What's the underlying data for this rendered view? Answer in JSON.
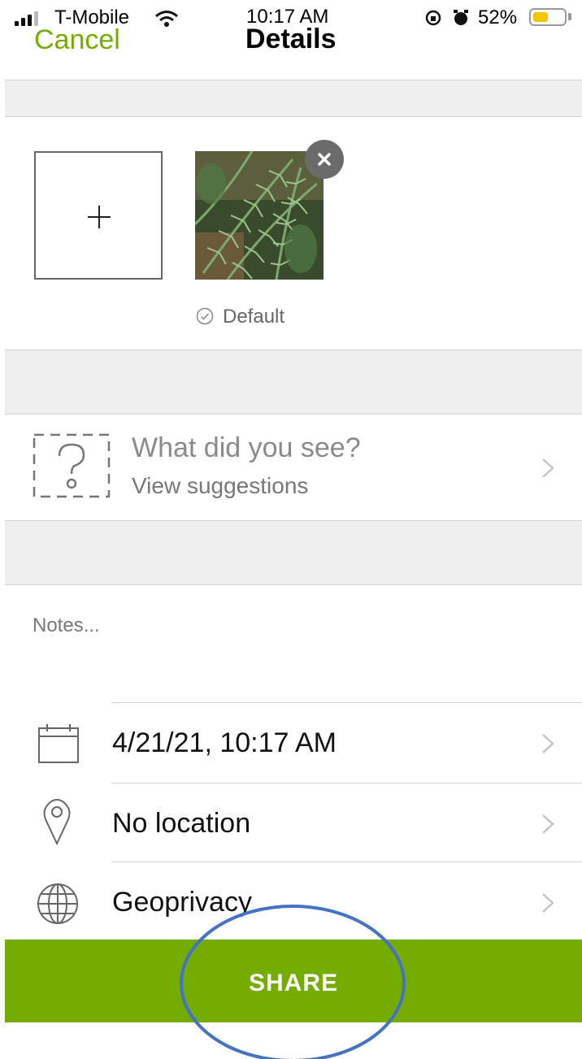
{
  "status_bar": {
    "carrier": "T-Mobile",
    "time": "10:17 AM",
    "battery_percent": "52%"
  },
  "nav": {
    "cancel_label": "Cancel",
    "title": "Details"
  },
  "photos": {
    "default_label": "Default"
  },
  "identification": {
    "prompt": "What did you see?",
    "suggestions_label": "View suggestions"
  },
  "notes": {
    "placeholder": "Notes..."
  },
  "details": {
    "date_label": "4/21/21, 10:17 AM",
    "location_label": "No location",
    "geoprivacy_label": "Geoprivacy"
  },
  "share": {
    "label": "SHARE"
  },
  "colors": {
    "accent": "#74ac00",
    "highlight_ring": "#4472c4"
  }
}
